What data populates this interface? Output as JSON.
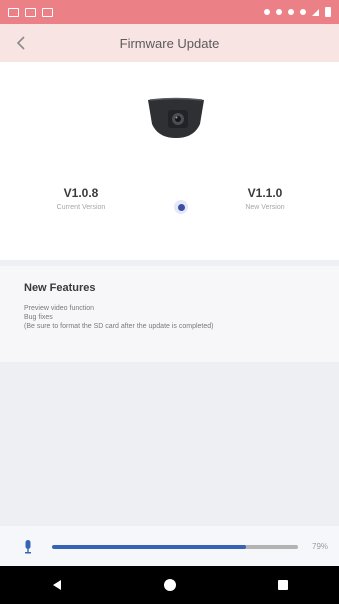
{
  "header": {
    "title": "Firmware Update"
  },
  "versions": {
    "current": {
      "number": "V1.0.8",
      "label": "Current Version"
    },
    "new": {
      "number": "V1.1.0",
      "label": "New Version"
    }
  },
  "features": {
    "title": "New Features",
    "lines": [
      "Preview video function",
      "Bug fixes",
      "(Be sure to format the SD card after the update is completed)"
    ]
  },
  "progress": {
    "percent": 79,
    "label": "79%"
  },
  "icons": {
    "back": "chevron-left-icon",
    "device": "dashcam-icon",
    "arrow": "update-arrow-icon",
    "progress": "mic-icon"
  },
  "colors": {
    "status_bar": "#ec8087",
    "header": "#f9e4e4",
    "accent": "#3763b4",
    "progress_track": "#b3b3b3"
  }
}
